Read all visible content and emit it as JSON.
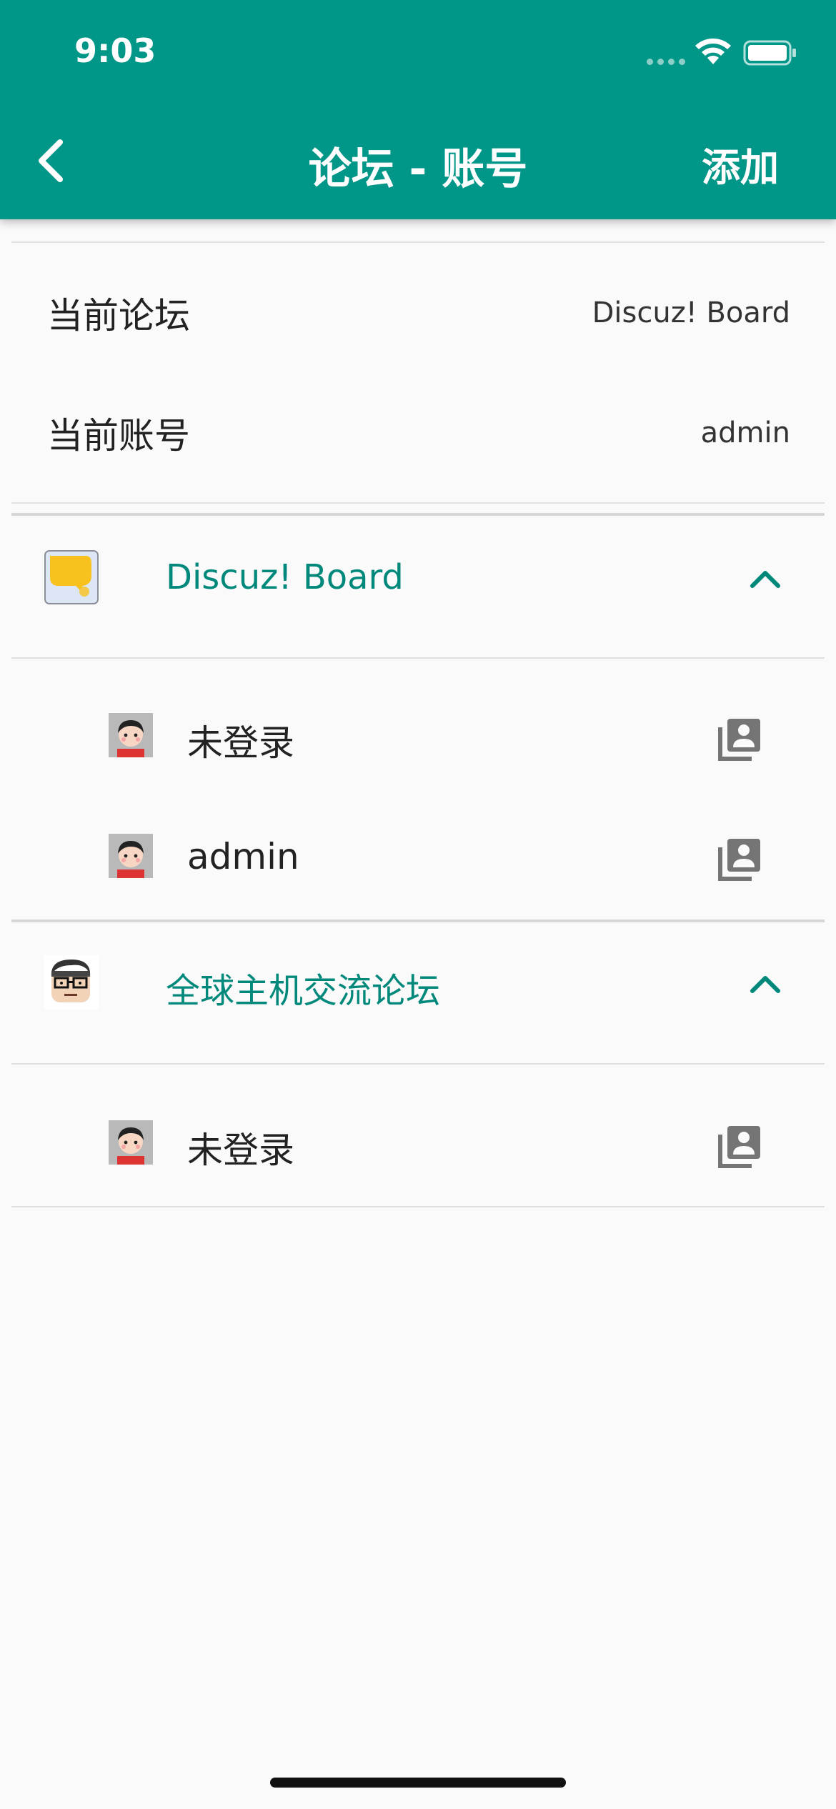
{
  "status_bar": {
    "time": "9:03"
  },
  "app_bar": {
    "title": "论坛 - 账号",
    "add_label": "添加",
    "back_icon": "chevron-left-icon",
    "background": "#009688"
  },
  "current": {
    "forum_label": "当前论坛",
    "forum_value": "Discuz! Board",
    "account_label": "当前账号",
    "account_value": "admin"
  },
  "forums": [
    {
      "name": "Discuz! Board",
      "icon": "discuz-logo-icon",
      "expanded": true,
      "accounts": [
        {
          "name": "未登录",
          "avatar": "default-avatar-icon",
          "action_icon": "switch-account-icon"
        },
        {
          "name": "admin",
          "avatar": "default-avatar-icon",
          "action_icon": "switch-account-icon"
        }
      ]
    },
    {
      "name": "全球主机交流论坛",
      "icon": "hostloc-logo-icon",
      "expanded": true,
      "accounts": [
        {
          "name": "未登录",
          "avatar": "default-avatar-icon",
          "action_icon": "switch-account-icon"
        }
      ]
    }
  ],
  "colors": {
    "accent": "#009688",
    "accent_text": "#00897b",
    "background": "#fafafa"
  }
}
